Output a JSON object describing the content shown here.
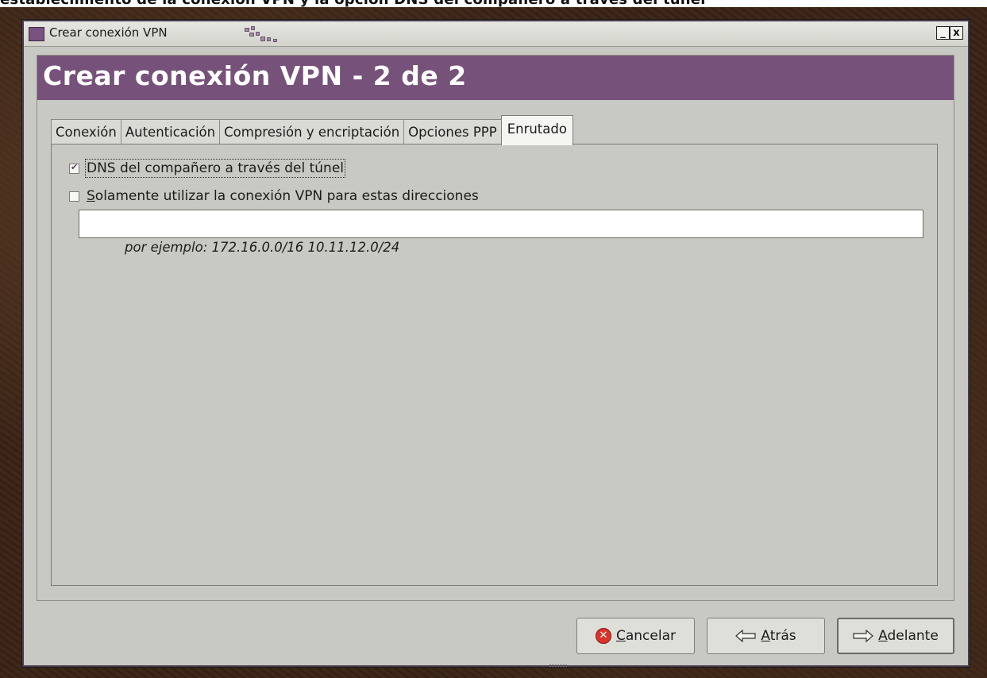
{
  "window": {
    "title": "Crear conexión VPN",
    "min_symbol": "_",
    "close_symbol": "x"
  },
  "top_strip_text": "establecimiento de la conexión VPN y la opción DNS del compañero a través del túnel",
  "header": {
    "title": "Crear conexión VPN - 2 de 2"
  },
  "tabs": [
    {
      "label": "Conexión",
      "active": false
    },
    {
      "label": "Autenticación",
      "active": false
    },
    {
      "label": "Compresión y encriptación",
      "active": false
    },
    {
      "label": "Opciones PPP",
      "active": false
    },
    {
      "label": "Enrutado",
      "active": true
    }
  ],
  "routing": {
    "peer_dns": {
      "label": "DNS del compañero a través del túnel",
      "checked": true
    },
    "only_vpn": {
      "mnemonic": "S",
      "label_rest": "olamente utilizar la conexión VPN para estas direcciones",
      "checked": false
    },
    "addresses_value": "",
    "hint": "por ejemplo: 172.16.0.0/16 10.11.12.0/24"
  },
  "buttons": {
    "cancel": {
      "mnemonic": "C",
      "rest": "ancelar",
      "icon": "cancel-icon"
    },
    "back": {
      "mnemonic": "A",
      "rest": "trás",
      "icon": "arrow-left-icon"
    },
    "forward": {
      "mnemonic": "A",
      "rest": "delante",
      "icon": "arrow-right-icon"
    }
  },
  "colors": {
    "header_bg": "#76517a",
    "window_bg": "#c8c9c2",
    "cancel_red": "#d9332b"
  }
}
